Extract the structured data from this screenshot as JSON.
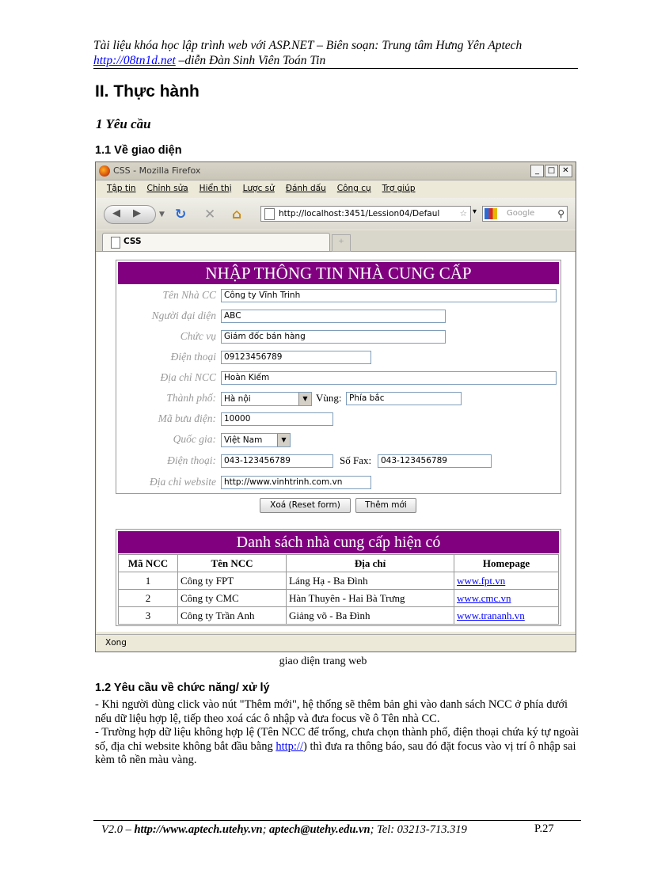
{
  "header": {
    "line1": "Tài liệu khóa học lập trình web với ASP.NET – Biên soạn: Trung tâm Hưng Yên Aptech",
    "link": "http://08tn1d.net",
    "line2_rest": " –diễn Đàn Sinh Viên Toán Tin"
  },
  "section_title": "II. Thực hành",
  "sub_title": "1 Yêu cầu",
  "sub_11": "1.1 Về giao diện",
  "browser": {
    "title": "CSS - Mozilla Firefox",
    "menu": [
      "Tập tin",
      "Chỉnh sửa",
      "Hiển thị",
      "Lược sử",
      "Đánh dấu",
      "Công cụ",
      "Trợ giúp"
    ],
    "url": "http://localhost:3451/Lession04/Defaul",
    "search_placeholder": "Google",
    "tab_label": "CSS",
    "status": "Xong"
  },
  "form": {
    "title": "NHẬP THÔNG TIN NHÀ CUNG CẤP",
    "fields": {
      "ten_ncc": {
        "label": "Tên Nhà CC",
        "value": "Công ty Vĩnh Trinh"
      },
      "nguoi_dai_dien": {
        "label": "Người đại diện",
        "value": "ABC"
      },
      "chuc_vu": {
        "label": "Chức vụ",
        "value": "Giám đốc bán hàng"
      },
      "dien_thoai1": {
        "label": "Điện thoại",
        "value": "09123456789"
      },
      "dia_chi": {
        "label": "Địa chỉ NCC",
        "value": "Hoàn Kiếm"
      },
      "thanh_pho": {
        "label": "Thành phố:",
        "value": "Hà nội"
      },
      "vung": {
        "label": "Vùng:",
        "value": "Phía bắc"
      },
      "ma_buu_dien": {
        "label": "Mã bưu điện:",
        "value": "10000"
      },
      "quoc_gia": {
        "label": "Quốc gia:",
        "value": "Việt Nam"
      },
      "dien_thoai2": {
        "label": "Điện thoại:",
        "value": "043-123456789"
      },
      "so_fax": {
        "label": "Số Fax:",
        "value": "043-123456789"
      },
      "website": {
        "label": "Địa chỉ website",
        "value": "http://www.vinhtrinh.com.vn"
      }
    },
    "btn_reset": "Xoá (Reset form)",
    "btn_add": "Thêm mới"
  },
  "list": {
    "title": "Danh sách nhà cung cấp hiện có",
    "columns": [
      "Mã NCC",
      "Tên NCC",
      "Địa chỉ",
      "Homepage"
    ],
    "rows": [
      [
        "1",
        "Công ty FPT",
        "Láng Hạ - Ba Đình",
        "www.fpt.vn"
      ],
      [
        "2",
        "Công ty CMC",
        "Hàn Thuyên - Hai Bà Trưng",
        "www.cmc.vn"
      ],
      [
        "3",
        "Công ty Trần Anh",
        "Giảng võ - Ba Đình",
        "www.trananh.vn"
      ]
    ]
  },
  "caption": "giao diện trang web",
  "sub_12": "1.2 Yêu cầu về chức năng/ xử lý",
  "para1": "- Khi người dùng click vào nút \"Thêm mới\", hệ thống sẽ thêm bản ghi vào danh sách NCC ở phía dưới nếu dữ liệu hợp lệ, tiếp theo xoá các ô nhập và đưa focus về ô Tên nhà CC.",
  "para2_a": "- Trường hợp dữ liệu không hợp lệ (Tên NCC để trống, chưa chọn thành phố, điện thoại chứa ký tự ngoài số, địa chỉ website không bắt đầu bằng ",
  "para2_link": "http://",
  "para2_b": ") thì đưa ra thông báo, sau đó đặt focus vào vị trí ô nhập sai kèm tô nền màu vàng.",
  "footer": {
    "version": "V2.0 – ",
    "site": "http://www.aptech.utehy.vn",
    "sep": "; ",
    "email": "aptech@utehy.edu.vn",
    "tel": "; Tel: 03213-713.319",
    "page": "P.27"
  },
  "colors": {
    "panel_title_bg": "#800080",
    "link": "#0000ff"
  }
}
